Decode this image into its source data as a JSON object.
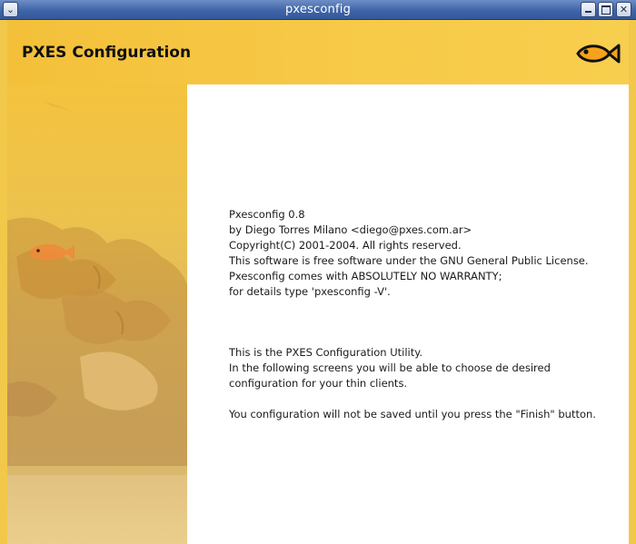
{
  "window": {
    "title": "pxesconfig",
    "menu_glyph": "⌄",
    "close_glyph": "✕"
  },
  "header": {
    "title": "PXES Configuration",
    "logo_icon": "fish-icon"
  },
  "content": {
    "about_lines": [
      "Pxesconfig 0.8",
      "by Diego Torres Milano <diego@pxes.com.ar>",
      "Copyright(C) 2001-2004. All rights reserved.",
      "This software is free software under the GNU General Public License.",
      "Pxesconfig comes with ABSOLUTELY NO WARRANTY;",
      "for details type 'pxesconfig -V'."
    ],
    "intro_lines": [
      "This is the PXES Configuration Utility.",
      "In the following screens you will be able to choose de desired",
      "configuration for your thin clients."
    ],
    "notice_lines": [
      "You configuration will not be saved until you press the \"Finish\" button."
    ]
  },
  "colors": {
    "titlebar": "#3f64a8",
    "header": "#f6c640",
    "content_bg": "#ffffff",
    "fish": "#111111"
  }
}
